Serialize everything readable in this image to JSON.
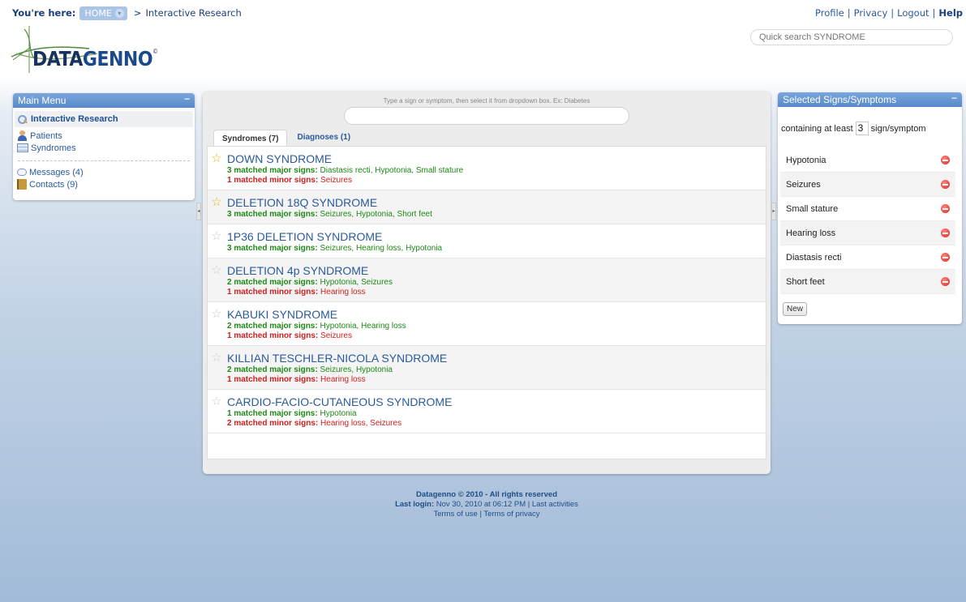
{
  "breadcrumb": {
    "prefix": "You're here:",
    "home": "HOME",
    "separator": ">",
    "current": "Interactive Research"
  },
  "top_links": {
    "profile": "Profile",
    "privacy": "Privacy",
    "logout": "Logout",
    "help": "Help",
    "sep": "|"
  },
  "quick_search": {
    "placeholder": "Quick search SYNDROME"
  },
  "logo": {
    "text_a": "DATA",
    "text_b": "GENNO",
    "mark": "©"
  },
  "main_menu": {
    "title": "Main Menu",
    "collapse": "−",
    "active": "Interactive Research",
    "items": [
      "Patients",
      "Syndromes"
    ],
    "items2": [
      "Messages (4)",
      "Contacts (9)"
    ]
  },
  "search_panel": {
    "hint": "Type a sign or symptom, then select it from dropdown box. Ex: Diabetes",
    "input_value": "",
    "tabs": [
      "Syndromes (7)",
      "Diagnoses (1)"
    ]
  },
  "results": [
    {
      "name": "DOWN SYNDROME",
      "starred": true,
      "major_label": "3 matched major signs:",
      "major": "Diastasis recti, Hypotonia, Small stature",
      "minor_label": "1 matched minor signs:",
      "minor": "Seizures"
    },
    {
      "name": "DELETION 18Q SYNDROME",
      "starred": true,
      "major_label": "3 matched major signs:",
      "major": "Seizures, Hypotonia, Short feet",
      "minor_label": "",
      "minor": ""
    },
    {
      "name": "1P36 DELETION SYNDROME",
      "starred": false,
      "major_label": "3 matched major signs:",
      "major": "Seizures, Hearing loss, Hypotonia",
      "minor_label": "",
      "minor": ""
    },
    {
      "name": "DELETION 4p SYNDROME",
      "starred": false,
      "major_label": "2 matched major signs:",
      "major": "Hypotonia, Seizures",
      "minor_label": "1 matched minor signs:",
      "minor": "Hearing loss"
    },
    {
      "name": "KABUKI SYNDROME",
      "starred": false,
      "major_label": "2 matched major signs:",
      "major": "Hypotonia, Hearing loss",
      "minor_label": "1 matched minor signs:",
      "minor": "Seizures"
    },
    {
      "name": "KILLIAN TESCHLER-NICOLA SYNDROME",
      "starred": false,
      "major_label": "2 matched major signs:",
      "major": "Seizures, Hypotonia",
      "minor_label": "1 matched minor signs:",
      "minor": "Hearing loss"
    },
    {
      "name": "CARDIO-FACIO-CUTANEOUS SYNDROME",
      "starred": false,
      "major_label": "1 matched major signs:",
      "major": "Hypotonia",
      "minor_label": "2 matched minor signs:",
      "minor": "Hearing loss, Seizures"
    }
  ],
  "selected_panel": {
    "title": "Selected Signs/Symptoms",
    "collapse": "−",
    "threshold_prefix": "containing at least",
    "threshold_value": "3",
    "threshold_suffix": "sign/symptom",
    "signs": [
      "Hypotonia",
      "Seizures",
      "Small stature",
      "Hearing loss",
      "Diastasis recti",
      "Short feet"
    ],
    "new_button": "New"
  },
  "footer": {
    "copyright": "Datagenno © 2010 - All rights reserved",
    "last_login_label": "Last login:",
    "last_login_value": "Nov 30, 2010 at 06:12 PM | Last activities",
    "terms_of_use": "Terms of use",
    "sep": "|",
    "terms_of_privacy": "Terms of privacy"
  },
  "colors": {
    "major": "#1d8a16",
    "minor": "#d31d1d",
    "title_link": "#2d5fa6",
    "panel_header": "#5688c9",
    "star_on": "#e8b81b"
  }
}
